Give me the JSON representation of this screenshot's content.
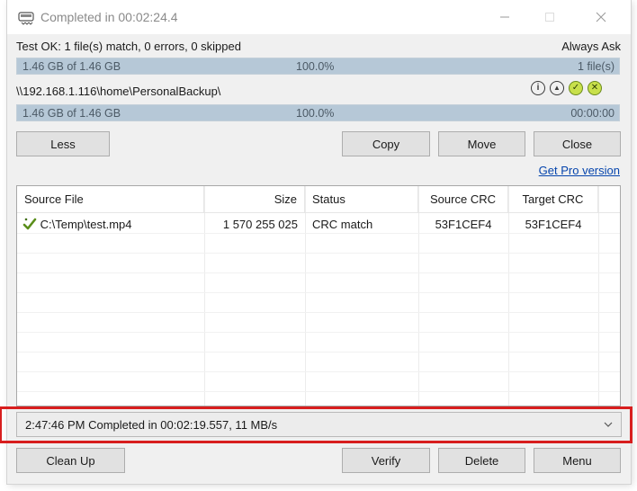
{
  "window": {
    "title": "Completed in 00:02:24.4"
  },
  "status": {
    "summary": "Test OK: 1 file(s) match, 0 errors, 0 skipped",
    "mode": "Always Ask"
  },
  "progress_total": {
    "left": "1.46 GB of 1.46 GB",
    "percent_text": "100.0%",
    "right": "1 file(s)",
    "fill": 1.0
  },
  "destination": {
    "path": "\\\\192.168.1.116\\home\\PersonalBackup\\"
  },
  "progress_dest": {
    "left": "1.46 GB of 1.46 GB",
    "percent_text": "100.0%",
    "right": "00:00:00",
    "fill": 1.0
  },
  "buttons": {
    "less": "Less",
    "copy": "Copy",
    "move": "Move",
    "close": "Close",
    "clean_up": "Clean Up",
    "verify": "Verify",
    "delete": "Delete",
    "menu": "Menu"
  },
  "links": {
    "pro": "Get Pro version"
  },
  "table": {
    "columns": [
      "Source File",
      "Size",
      "Status",
      "Source CRC",
      "Target CRC"
    ],
    "rows": [
      {
        "icon": "check-icon",
        "file": "C:\\Temp\\test.mp4",
        "size": "1 570 255 025",
        "status": "CRC match",
        "source_crc": "53F1CEF4",
        "target_crc": "53F1CEF4"
      }
    ]
  },
  "log": {
    "selected": "2:47:46 PM Completed in 00:02:19.557, 11 MB/s"
  },
  "colors": {
    "progress_fill": "#b6c8d7",
    "highlight": "#d81e1e",
    "link": "#0645ad"
  }
}
